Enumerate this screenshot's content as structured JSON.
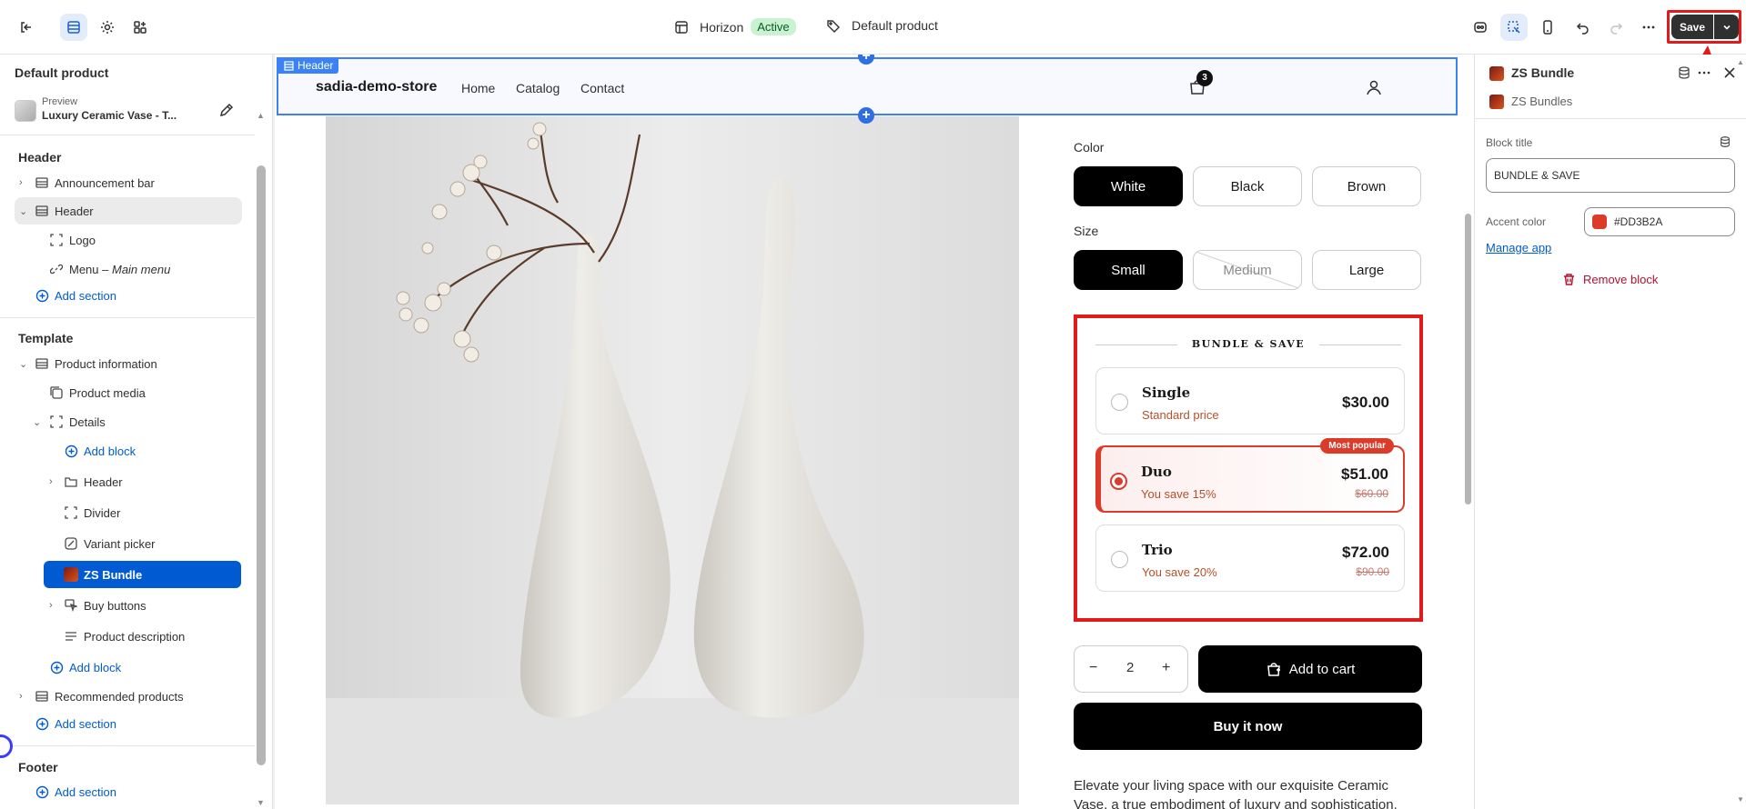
{
  "topbar": {
    "theme_name": "Horizon",
    "theme_status": "Active",
    "template_name": "Default product",
    "save_label": "Save"
  },
  "left_panel": {
    "title": "Default product",
    "preview_label": "Preview",
    "preview_value": "Luxury Ceramic Vase - T...",
    "header_section": "Header",
    "template_section": "Template",
    "footer_section": "Footer",
    "items": {
      "announcement_bar": "Announcement bar",
      "header": "Header",
      "logo": "Logo",
      "menu": "Menu – ",
      "menu_sub": "Main menu",
      "add_section_1": "Add section",
      "product_information": "Product information",
      "product_media": "Product media",
      "details": "Details",
      "add_block_1": "Add block",
      "header_block": "Header",
      "divider": "Divider",
      "variant_picker": "Variant picker",
      "zs_bundle": "ZS Bundle",
      "buy_buttons": "Buy buttons",
      "product_description": "Product description",
      "add_block_2": "Add block",
      "recommended_products": "Recommended products",
      "add_section_2": "Add section",
      "add_section_3": "Add section"
    }
  },
  "store": {
    "header_tag": "Header",
    "name": "sadia-demo-store",
    "nav": [
      "Home",
      "Catalog",
      "Contact"
    ],
    "cart_count": "3",
    "color_label": "Color",
    "colors": [
      "White",
      "Black",
      "Brown"
    ],
    "size_label": "Size",
    "sizes": [
      "Small",
      "Medium",
      "Large"
    ],
    "bundle": {
      "title": "BUNDLE & SAVE",
      "popular_badge": "Most popular",
      "tiers": [
        {
          "name": "Single",
          "sub": "Standard price",
          "price": "$30.00",
          "compare": ""
        },
        {
          "name": "Duo",
          "sub": "You save 15%",
          "price": "$51.00",
          "compare": "$60.00"
        },
        {
          "name": "Trio",
          "sub": "You save 20%",
          "price": "$72.00",
          "compare": "$90.00"
        }
      ],
      "selected_tier": "Duo"
    },
    "quantity": "2",
    "add_to_cart": "Add to cart",
    "buy_now": "Buy it now",
    "description": "Elevate your living space with our exquisite Ceramic Vase, a true embodiment of luxury and sophistication."
  },
  "right_panel": {
    "title": "ZS Bundle",
    "subtitle": "ZS Bundles",
    "block_title_label": "Block title",
    "block_title_value": "BUNDLE & SAVE",
    "accent_label": "Accent color",
    "accent_value": "#DD3B2A",
    "manage_app": "Manage app",
    "remove_block": "Remove block"
  },
  "colors": {
    "accent": "#DD3B2A",
    "selection_blue": "#005bd3",
    "highlight_red": "#e21a1a"
  }
}
